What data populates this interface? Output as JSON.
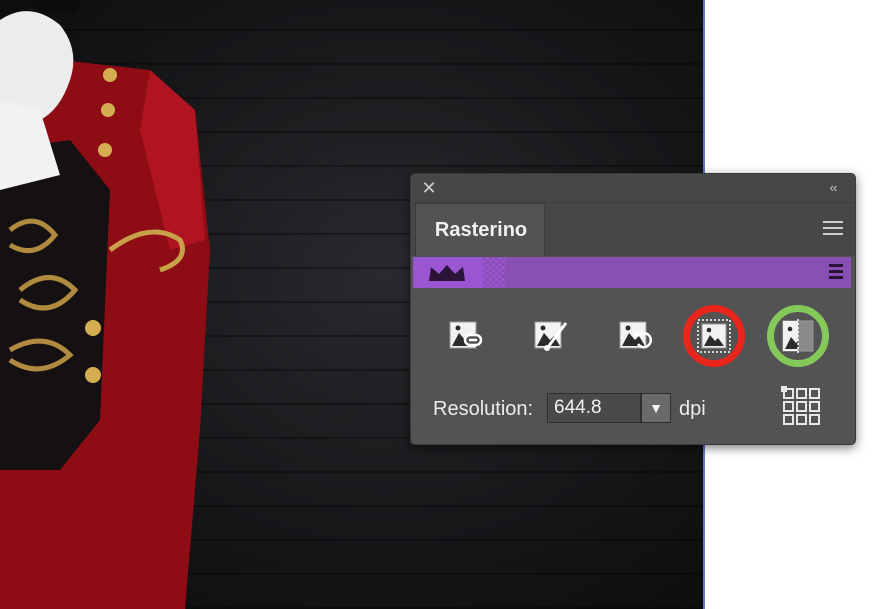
{
  "panel": {
    "close_glyph": "✕",
    "collapse_glyph": "‹‹",
    "tab_label": "Rasterino",
    "menu_icon": "hamburger-menu-icon"
  },
  "banner": {
    "logo_icon": "crown-icon",
    "menu_icon": "banner-menu-icon",
    "color": "#8a4fb3"
  },
  "tools": [
    {
      "name": "link-image-tool",
      "icon": "image-link-icon"
    },
    {
      "name": "embed-image-tool",
      "icon": "image-embed-brush-icon"
    },
    {
      "name": "revert-image-tool",
      "icon": "image-revert-icon"
    },
    {
      "name": "rasterize-selection-tool",
      "icon": "image-crop-selection-icon",
      "highlight": "#e8261c"
    },
    {
      "name": "split-image-tool",
      "icon": "image-split-icon",
      "highlight": "#85c95a"
    }
  ],
  "resolution": {
    "label": "Resolution:",
    "value": "644.8",
    "dropdown_glyph": "▼",
    "unit": "dpi"
  },
  "colors": {
    "panel_bg": "#535353",
    "artboard_edge": "#5d79c2"
  }
}
